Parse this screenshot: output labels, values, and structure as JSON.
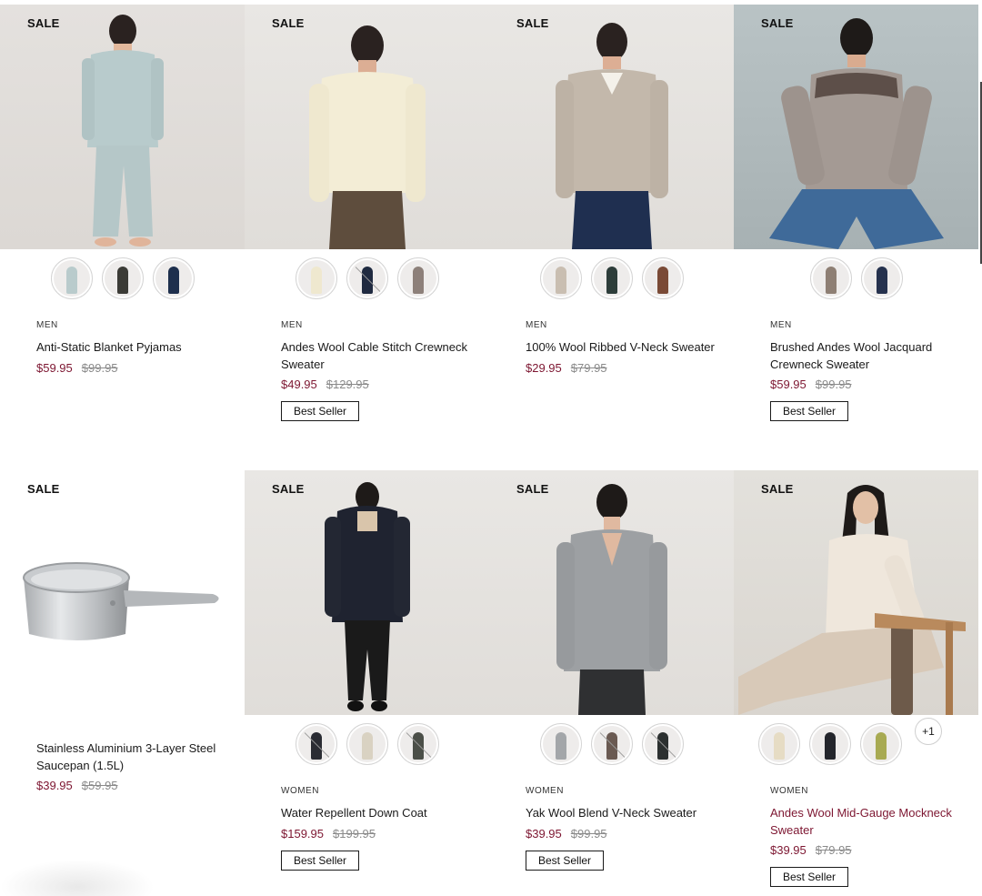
{
  "colors": {
    "sale_price": "#7d1631",
    "accent_name": "#7d1631",
    "was_price": "#8a8a8a"
  },
  "products": [
    {
      "sale": "SALE",
      "category": "MEN",
      "name": "Anti-Static Blanket Pyjamas",
      "price": "$59.95",
      "was": "$99.95",
      "badge": "",
      "swatches": [
        {
          "color": "#b9cbcc",
          "oos": false
        },
        {
          "color": "#3b3b36",
          "oos": false
        },
        {
          "color": "#1e2f4d",
          "oos": false
        }
      ]
    },
    {
      "sale": "SALE",
      "category": "MEN",
      "name": "Andes Wool Cable Stitch Crewneck Sweater",
      "price": "$49.95",
      "was": "$129.95",
      "badge": "Best Seller",
      "swatches": [
        {
          "color": "#efe8cf",
          "oos": false
        },
        {
          "color": "#1f2a40",
          "oos": true
        },
        {
          "color": "#8d807a",
          "oos": false
        }
      ]
    },
    {
      "sale": "SALE",
      "category": "MEN",
      "name": "100% Wool Ribbed V-Neck Sweater",
      "price": "$29.95",
      "was": "$79.95",
      "badge": "",
      "swatches": [
        {
          "color": "#c9beb1",
          "oos": false
        },
        {
          "color": "#2d3d3a",
          "oos": false
        },
        {
          "color": "#7a4a36",
          "oos": false
        }
      ]
    },
    {
      "sale": "SALE",
      "category": "MEN",
      "name": "Brushed Andes Wool Jacquard Crewneck Sweater",
      "price": "$59.95",
      "was": "$99.95",
      "badge": "Best Seller",
      "swatches": [
        {
          "color": "#8e7f74",
          "oos": false
        },
        {
          "color": "#26324e",
          "oos": false
        }
      ]
    },
    {
      "sale": "SALE",
      "category": "",
      "name": "Stainless Aluminium 3-Layer Steel Saucepan (1.5L)",
      "price": "$39.95",
      "was": "$59.95",
      "badge": "",
      "swatches": []
    },
    {
      "sale": "SALE",
      "category": "WOMEN",
      "name": "Water Repellent Down Coat",
      "price": "$159.95",
      "was": "$199.95",
      "badge": "Best Seller",
      "swatches": [
        {
          "color": "#2a2c33",
          "oos": true
        },
        {
          "color": "#d9d2c2",
          "oos": false
        },
        {
          "color": "#4b4f48",
          "oos": true
        }
      ]
    },
    {
      "sale": "SALE",
      "category": "WOMEN",
      "name": "Yak Wool Blend V-Neck Sweater",
      "price": "$39.95",
      "was": "$99.95",
      "badge": "Best Seller",
      "swatches": [
        {
          "color": "#a3a6a9",
          "oos": false
        },
        {
          "color": "#6a5a52",
          "oos": true
        },
        {
          "color": "#2c3030",
          "oos": true
        }
      ]
    },
    {
      "sale": "SALE",
      "category": "WOMEN",
      "name": "Andes Wool Mid-Gauge Mockneck Sweater",
      "price": "$39.95",
      "was": "$79.95",
      "badge": "Best Seller",
      "swatches": [
        {
          "color": "#e6dcc4",
          "oos": false
        },
        {
          "color": "#23252b",
          "oos": false
        },
        {
          "color": "#a8aa52",
          "oos": false
        }
      ],
      "more": "+1"
    }
  ]
}
